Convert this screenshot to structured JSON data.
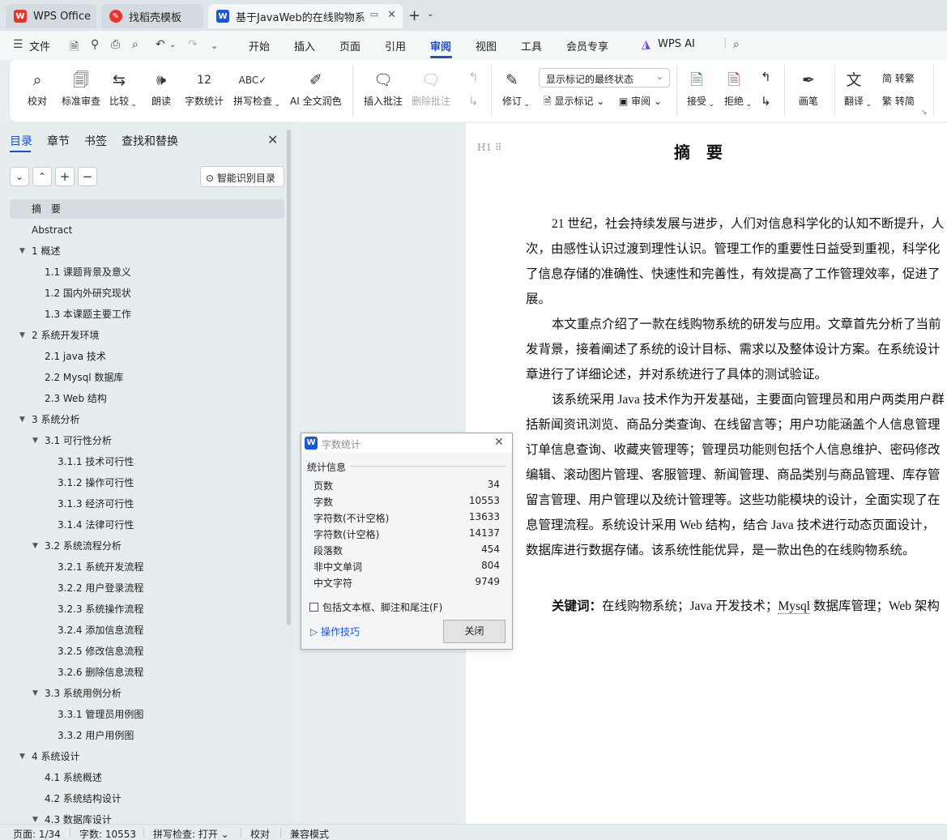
{
  "tabs": [
    {
      "label": "WPS Office",
      "icon": "wps-logo-icon"
    },
    {
      "label": "找稻壳模板",
      "icon": "docer-icon"
    },
    {
      "label": "基于JavaWeb的在线购物系统",
      "icon": "word-doc-icon"
    }
  ],
  "menu": {
    "file": "文件",
    "items": [
      "开始",
      "插入",
      "页面",
      "引用",
      "审阅",
      "视图",
      "工具",
      "会员专享",
      "WPS AI"
    ],
    "active": "审阅"
  },
  "ribbon": {
    "proofread": "校对",
    "standard_review": "标准审查",
    "compare": "比较",
    "read_aloud": "朗读",
    "word_count": "字数统计",
    "spell_check": "拼写检查",
    "ai_polish": "AI 全文润色",
    "insert_comment": "插入批注",
    "delete_comment": "删除批注",
    "revise": "修订",
    "markup_select": "显示标记的最终状态",
    "show_markup": "显示标记",
    "review": "审阅",
    "accept": "接受",
    "reject": "拒绝",
    "pen": "画笔",
    "translate": "翻译",
    "trad_simp_to_trad": "简 转繁",
    "trad_simp_to_simp": "繁 转简",
    "word_count_badge": "12"
  },
  "panel": {
    "tabs": [
      "目录",
      "章节",
      "书签",
      "查找和替换"
    ],
    "ai_toc": "智能识别目录",
    "toc": [
      {
        "label": "摘　要",
        "level": 1,
        "selected": true
      },
      {
        "label": "Abstract",
        "level": 1
      },
      {
        "label": "1  概述",
        "level": 1,
        "expanded": true
      },
      {
        "label": "1.1 课题背景及意义",
        "level": 2
      },
      {
        "label": "1.2  国内外研究现状",
        "level": 2
      },
      {
        "label": "1.3  本课题主要工作",
        "level": 2
      },
      {
        "label": "2  系统开发环境",
        "level": 1,
        "expanded": true
      },
      {
        "label": "2.1 java 技术",
        "level": 2
      },
      {
        "label": "2.2 Mysql 数据库",
        "level": 2
      },
      {
        "label": "2.3 Web 结构",
        "level": 2
      },
      {
        "label": "3  系统分析",
        "level": 1,
        "expanded": true
      },
      {
        "label": "3.1  可行性分析",
        "level": 2,
        "expanded": true
      },
      {
        "label": "3.1.1  技术可行性",
        "level": 3
      },
      {
        "label": "3.1.2 操作可行性",
        "level": 3
      },
      {
        "label": "3.1.3  经济可行性",
        "level": 3
      },
      {
        "label": "3.1.4  法律可行性",
        "level": 3
      },
      {
        "label": "3.2 系统流程分析",
        "level": 2,
        "expanded": true
      },
      {
        "label": "3.2.1 系统开发流程",
        "level": 3
      },
      {
        "label": "3.2.2  用户登录流程",
        "level": 3
      },
      {
        "label": "3.2.3  系统操作流程",
        "level": 3
      },
      {
        "label": "3.2.4  添加信息流程",
        "level": 3
      },
      {
        "label": "3.2.5  修改信息流程",
        "level": 3
      },
      {
        "label": "3.2.6  删除信息流程",
        "level": 3
      },
      {
        "label": "3.3 系统用例分析",
        "level": 2,
        "expanded": true
      },
      {
        "label": "3.3.1 管理员用例图",
        "level": 3
      },
      {
        "label": "3.3.2 用户用例图",
        "level": 3
      },
      {
        "label": "4  系统设计",
        "level": 1,
        "expanded": true
      },
      {
        "label": "4.1  系统概述",
        "level": 2
      },
      {
        "label": "4.2  系统结构设计",
        "level": 2
      },
      {
        "label": "4.3 数据库设计",
        "level": 2,
        "expanded": true
      }
    ]
  },
  "document": {
    "heading_mark": "H1",
    "title": "摘要",
    "lines": [
      "21 世纪，社会持续发展与进步，人们对信息科学化的认知不断提升，人",
      "次，由感性认识过渡到理性认识。管理工作的重要性日益受到重视，科学化",
      "了信息存储的准确性、快速性和完善性，有效提高了工作管理效率，促进了",
      "展。",
      "本文重点介绍了一款在线购物系统的研发与应用。文章首先分析了当前",
      "发背景，接着阐述了系统的设计目标、需求以及整体设计方案。在系统设计",
      "章进行了详细论述，并对系统进行了具体的测试验证。",
      "该系统采用 Java 技术作为开发基础，主要面向管理员和用户两类用户群",
      "括新闻资讯浏览、商品分类查询、在线留言等；用户功能涵盖个人信息管理",
      "订单信息查询、收藏夹管理等；管理员功能则包括个人信息维护、密码修改",
      "编辑、滚动图片管理、客服管理、新闻管理、商品类别与商品管理、库存管",
      "留言管理、用户管理以及统计管理等。这些功能模块的设计，全面实现了在",
      "息管理流程。系统设计采用 Web 结构，结合 Java 技术进行动态页面设计，",
      "数据库进行数据存储。该系统性能优异，是一款出色的在线购物系统。"
    ],
    "keywords_label": "关键词：",
    "keywords_text_a": "在线购物系统；Java 开发技术；",
    "keywords_mysql": "Mysql",
    "keywords_text_b": " 数据库管理；Web 架构"
  },
  "dialog": {
    "title": "字数统计",
    "group": "统计信息",
    "rows": [
      {
        "label": "页数",
        "value": "34"
      },
      {
        "label": "字数",
        "value": "10553"
      },
      {
        "label": "字符数(不计空格)",
        "value": "13633"
      },
      {
        "label": "字符数(计空格)",
        "value": "14137"
      },
      {
        "label": "段落数",
        "value": "454"
      },
      {
        "label": "非中文单词",
        "value": "804"
      },
      {
        "label": "中文字符",
        "value": "9749"
      }
    ],
    "checkbox_label": "包括文本框、脚注和尾注(F)",
    "tips": "操作技巧",
    "close": "关闭"
  },
  "status": {
    "page": "页面: 1/34",
    "words": "字数: 10553",
    "spell": "拼写检查: 打开",
    "proof": "校对",
    "compat": "兼容模式"
  },
  "colors": {
    "accent": "#1a4fd6",
    "wps_red": "#e8342a",
    "word_blue": "#1a57e0"
  }
}
